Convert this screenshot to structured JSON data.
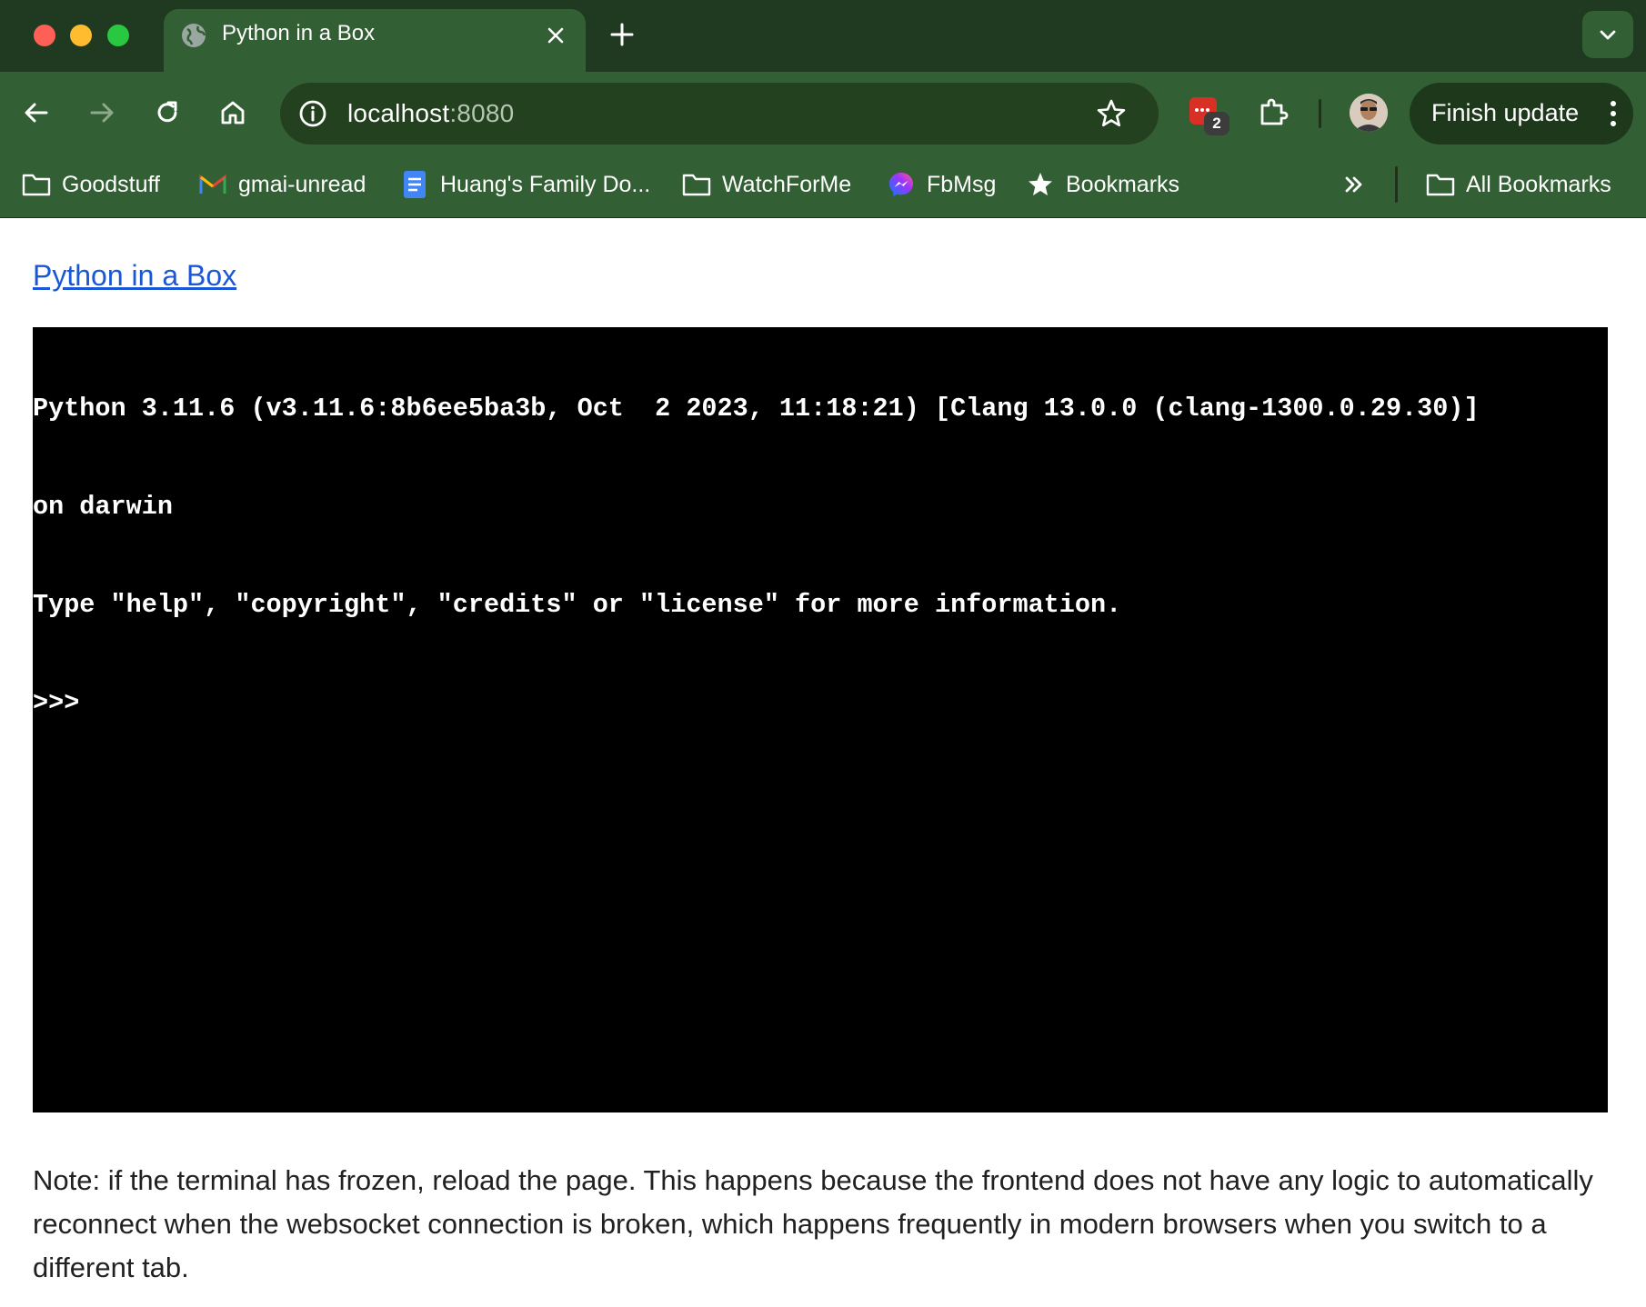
{
  "browser": {
    "tab": {
      "title": "Python in a Box"
    },
    "address": {
      "host": "localhost",
      "port": ":8080"
    },
    "extension_badge_count": "2",
    "finish_update_label": "Finish update",
    "bookmarks": [
      {
        "label": "Goodstuff",
        "icon": "folder-icon"
      },
      {
        "label": "gmai-unread",
        "icon": "gmail-icon"
      },
      {
        "label": "Huang's Family Do...",
        "icon": "docs-icon"
      },
      {
        "label": "WatchForMe",
        "icon": "folder-icon"
      },
      {
        "label": "FbMsg",
        "icon": "messenger-icon"
      },
      {
        "label": "Bookmarks",
        "icon": "star-icon"
      }
    ],
    "all_bookmarks_label": "All Bookmarks",
    "colors": {
      "tabstrip": "#1f3a20",
      "toolbar": "#325f33",
      "omnibox": "#23401f"
    }
  },
  "page": {
    "link_text": "Python in a Box",
    "terminal_lines": [
      "Python 3.11.6 (v3.11.6:8b6ee5ba3b, Oct  2 2023, 11:18:21) [Clang 13.0.0 (clang-1300.0.29.30)]",
      "on darwin",
      "Type \"help\", \"copyright\", \"credits\" or \"license\" for more information.",
      ">>> "
    ],
    "note": "Note: if the terminal has frozen, reload the page. This happens because the frontend does not have any logic to automatically reconnect when the websocket connection is broken, which happens frequently in modern browsers when you switch to a different tab."
  }
}
